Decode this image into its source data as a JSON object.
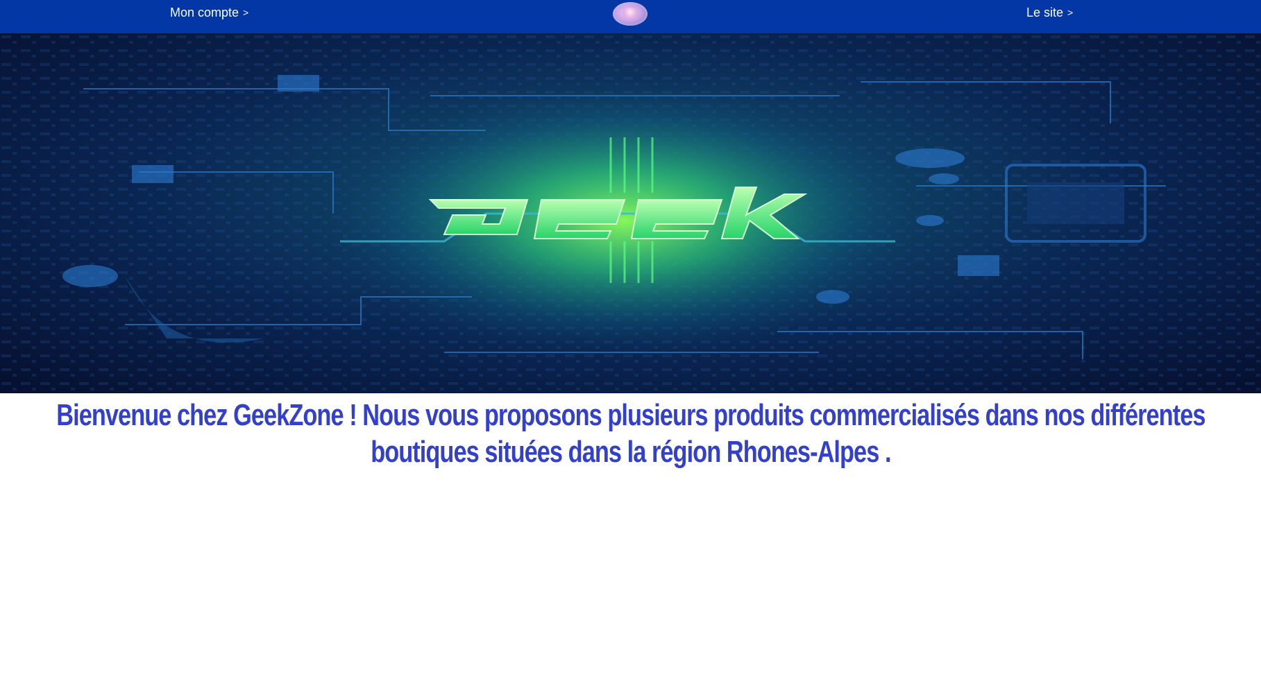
{
  "header": {
    "account_link": "Mon compte",
    "site_link": "Le site",
    "chevron": ">",
    "background_color": "#0437a6",
    "logo_icon": "avatar-logo-icon"
  },
  "hero": {
    "image_icon": "circuit-board-geek-banner",
    "banner_word": "geek",
    "accent_color": "#39ff7a"
  },
  "main": {
    "welcome_text": "Bienvenue chez GeekZone ! Nous vous proposons plusieurs produits commercialisés dans nos différentes boutiques situées dans la région Rhones-Alpes .",
    "text_color": "#3340cc"
  }
}
